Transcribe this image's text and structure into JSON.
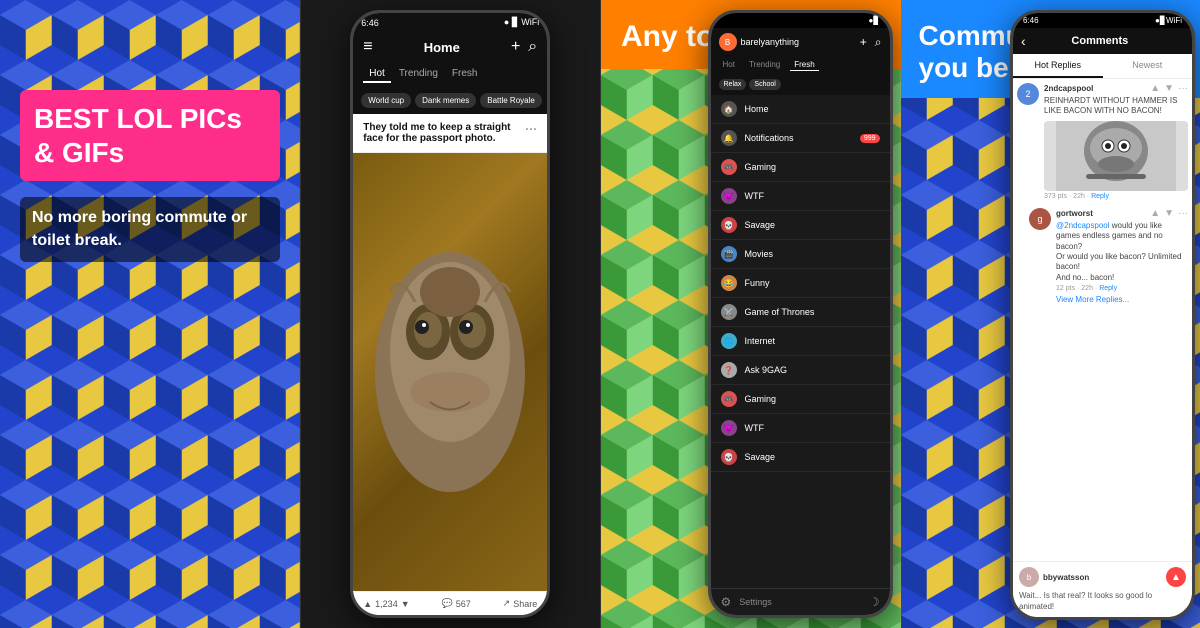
{
  "panel1": {
    "background_color": "#2244cc",
    "headline": "BEST LOL PICs & GIFs",
    "subtitle": "No more boring commute or toilet break."
  },
  "panel2": {
    "statusbar_time": "6:46",
    "statusbar_signal": "●●●",
    "nav_title": "Home",
    "nav_add": "+",
    "nav_search": "🔍",
    "nav_menu": "≡",
    "tabs": [
      "Hot",
      "Trending",
      "Fresh"
    ],
    "active_tab": "Hot",
    "tags": [
      "World cup",
      "Dank memes",
      "Battle Royale"
    ],
    "post_title": "They told me to keep a straight face for the passport photo.",
    "post_dots": "···",
    "footer_comments": "567",
    "footer_share": "Share",
    "footer_upvote": "1,234"
  },
  "panel3": {
    "header_text": "Any topic you like",
    "background_color": "#e8c840",
    "accent_color": "#ff7f00",
    "phone": {
      "statusbar_time": "",
      "topbar_user": "barelyanything",
      "tabs": [
        "Hot",
        "Trending",
        "Fresh"
      ],
      "active_tab": "Fresh",
      "tags": [
        "Relax",
        "School"
      ],
      "menu_items": [
        {
          "icon": "🏠",
          "label": "Home"
        },
        {
          "icon": "🔔",
          "label": "Notifications",
          "badge": "999"
        },
        {
          "icon": "🎮",
          "label": "Gaming"
        },
        {
          "icon": "😈",
          "label": "WTF"
        },
        {
          "icon": "💀",
          "label": "Savage"
        },
        {
          "icon": "🎬",
          "label": "Movies"
        },
        {
          "icon": "😂",
          "label": "Funny"
        },
        {
          "icon": "⚔️",
          "label": "Game of Thrones"
        },
        {
          "icon": "🌐",
          "label": "Internet"
        },
        {
          "icon": "❓",
          "label": "Ask 9GAG"
        },
        {
          "icon": "🎮",
          "label": "Gaming"
        },
        {
          "icon": "😈",
          "label": "WTF"
        },
        {
          "icon": "💀",
          "label": "Savage"
        }
      ],
      "settings_label": "Settings"
    }
  },
  "panel4": {
    "header_text": "Community where you belong",
    "background_color": "#2244cc",
    "accent_color": "#1a88ff",
    "phone": {
      "statusbar_time": "6:46",
      "back_label": "‹",
      "title": "Comments",
      "tabs": [
        "Hot Replies",
        "Newest"
      ],
      "active_tab": "Hot Replies",
      "comments": [
        {
          "username": "2ndcapspool",
          "text": "REINHARDT WITHOUT HAMMER IS LIKE BACON WITH NO BACON!",
          "has_image": true,
          "image_emoji": "😐",
          "meta": "373 pts · 22h · Reply"
        },
        {
          "username": "gortworst",
          "text": "@2ndcapspool would you like games endless games and no bacon?\nOr would you like bacon? Unlimited bacon!\nAnd no... bacon!",
          "has_image": false,
          "meta": "12 pts · 22h · Reply",
          "view_more": "View More Replies..."
        }
      ],
      "bottom_user": "bbywatsson",
      "bottom_text": "Wait... Is that real? It looks so good lo animated!"
    }
  }
}
